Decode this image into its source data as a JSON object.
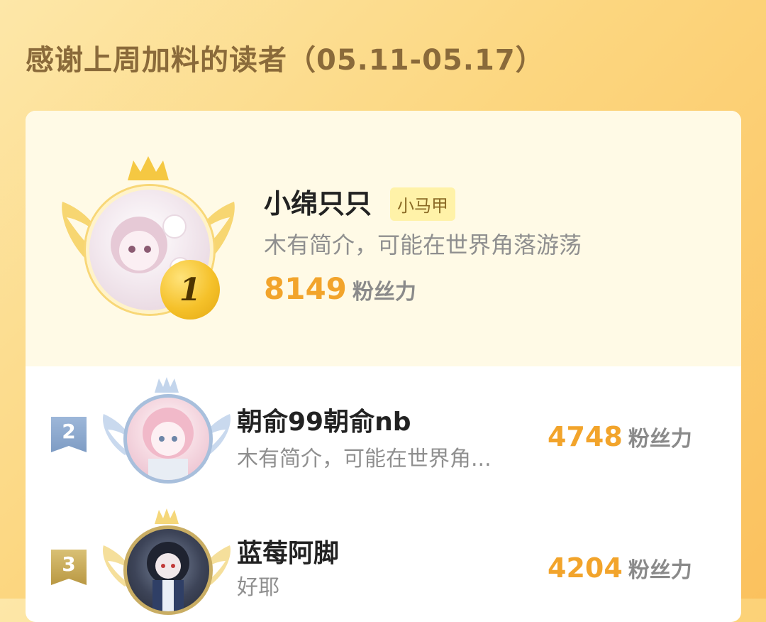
{
  "header": {
    "title": "感谢上周加料的读者（05.11-05.17）"
  },
  "top_reader": {
    "rank": "1",
    "name": "小绵只只",
    "tag": "小马甲",
    "bio": "木有简介，可能在世界角落游荡",
    "fans_value": "8149",
    "fans_unit": "粉丝力"
  },
  "readers": [
    {
      "rank": "2",
      "name": "朝俞99朝俞nb",
      "bio": "木有简介，可能在世界角...",
      "fans_value": "4748",
      "fans_unit": "粉丝力"
    },
    {
      "rank": "3",
      "name": "蓝莓阿脚",
      "bio": "好耶",
      "fans_value": "4204",
      "fans_unit": "粉丝力"
    }
  ],
  "colors": {
    "accent": "#f2a42b",
    "gold": "#f5c12a",
    "silver_blue": "#9db7d9",
    "bronze": "#c9ad63"
  }
}
